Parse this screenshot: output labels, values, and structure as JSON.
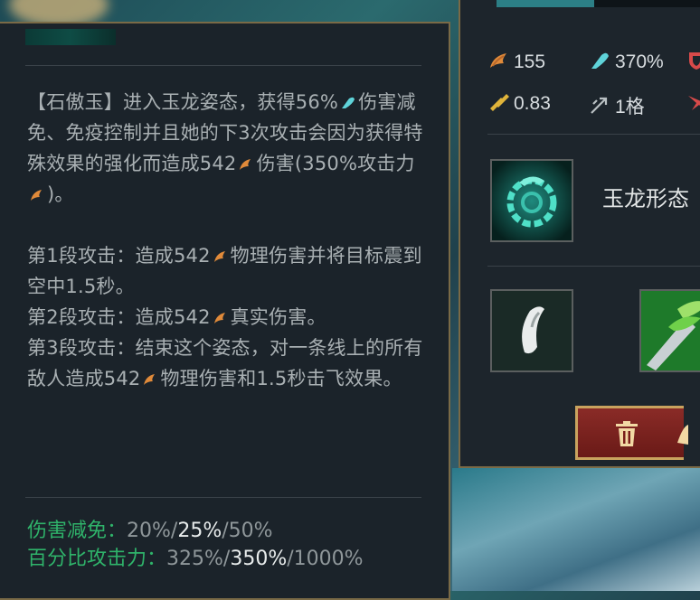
{
  "tooltip": {
    "paragraphs": [
      "【石傲玉】进入玉龙姿态，获得56%",
      "伤害减免、免疫控制并且她的下3次攻击会因为获得特殊效果的强化而造成542",
      "伤害(350%攻击力",
      ")。",
      "第1段攻击：造成542",
      "物理伤害并将目标震到空中1.5秒。",
      "第2段攻击：造成542",
      "真实伤害。",
      "第3段攻击：结束这个姿态，对一条线上的所有敌人造成542",
      "物理伤害和1.5秒击飞效果。"
    ],
    "stats": [
      {
        "label": "伤害减免：",
        "values": [
          "20%",
          "25%",
          "50%"
        ],
        "highlight": 1
      },
      {
        "label": "百分比攻击力：",
        "values": [
          "325%",
          "350%",
          "1000%"
        ],
        "highlight": 1
      }
    ]
  },
  "panel": {
    "mana_fill_percent": 45,
    "stats": [
      {
        "icon": "attack-damage-icon",
        "value": "155"
      },
      {
        "icon": "ability-power-icon",
        "value": "370%"
      },
      {
        "icon": "attack-speed-icon",
        "value": "0.83"
      },
      {
        "icon": "range-icon",
        "value": "1格"
      }
    ],
    "ability_name": "玉龙形态",
    "sell_icon": "trash-icon"
  },
  "colors": {
    "gold_border": "#7a6a46",
    "stat_label": "#2fb36a",
    "ad_orange": "#e08a3a",
    "ap_cyan": "#5fd3d9"
  }
}
